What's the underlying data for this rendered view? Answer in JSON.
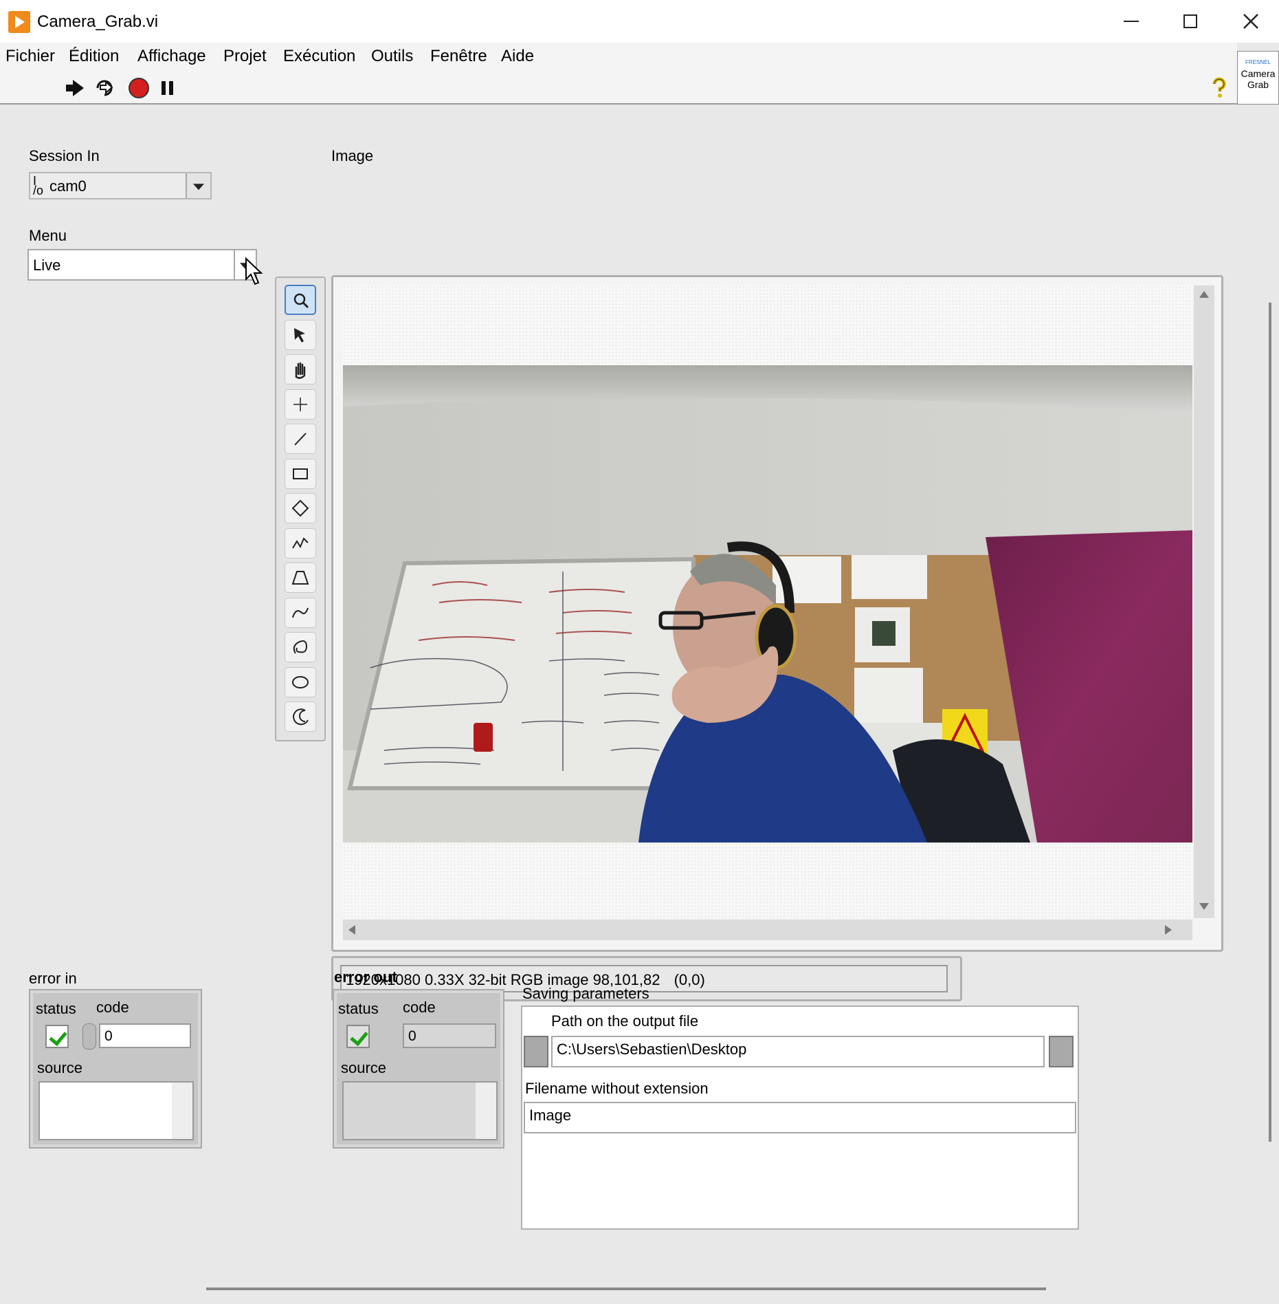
{
  "window": {
    "title": "Camera_Grab.vi",
    "controls": [
      "minimize",
      "maximize",
      "close"
    ]
  },
  "menubar": {
    "items": [
      "Fichier",
      "Édition",
      "Affichage",
      "Projet",
      "Exécution",
      "Outils",
      "Fenêtre",
      "Aide"
    ]
  },
  "toolbar": {
    "buttons": [
      "run-arrow-icon",
      "run-continuous-icon",
      "abort-icon",
      "pause-icon"
    ],
    "help": "help-icon"
  },
  "vi_icon": {
    "line1": "FRESNEL",
    "line2": "Camera",
    "line3": "Grab"
  },
  "session_in": {
    "label": "Session In",
    "value": "cam0"
  },
  "menu_control": {
    "label": "Menu",
    "value": "Live"
  },
  "image_display": {
    "label": "Image",
    "tools": [
      "zoom-tool-icon",
      "pointer-tool-icon",
      "pan-tool-icon",
      "point-tool-icon",
      "line-tool-icon",
      "rectangle-tool-icon",
      "rotated-rectangle-tool-icon",
      "polyline-tool-icon",
      "polygon-tool-icon",
      "freehand-line-tool-icon",
      "freehand-region-tool-icon",
      "ellipse-tool-icon",
      "annulus-tool-icon"
    ],
    "selected_tool": "zoom-tool-icon",
    "info": "1920x1080 0.33X 32-bit RGB image 98,101,82",
    "coords": "(0,0)"
  },
  "error_in": {
    "label": "error in",
    "status_label": "status",
    "code_label": "code",
    "code_value": "0",
    "source_label": "source",
    "source_value": ""
  },
  "error_out": {
    "label": "error out",
    "status_label": "status",
    "code_label": "code",
    "code_value": "0",
    "source_label": "source",
    "source_value": ""
  },
  "saving": {
    "label": "Saving parameters",
    "path_label": "Path on the output file",
    "path_value": "C:\\Users\\Sebastien\\Desktop",
    "filename_label": "Filename without extension",
    "filename_value": "Image"
  },
  "colors": {
    "panel": "#e8e8e8",
    "status_ok": "#1aa012",
    "tool_selected": "#cfe3f7",
    "purple_door": "#8a2a5e"
  }
}
